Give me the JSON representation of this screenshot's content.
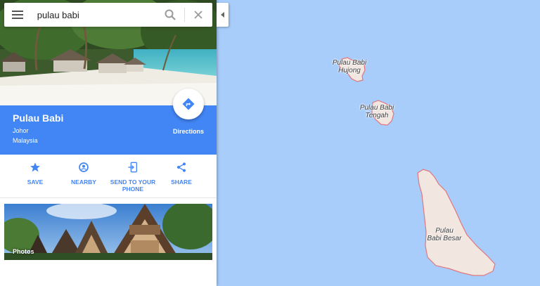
{
  "search": {
    "query": "pulau babi"
  },
  "place": {
    "name": "Pulau Babi",
    "state": "Johor",
    "country": "Malaysia",
    "directions_label": "Directions"
  },
  "actions": [
    {
      "label": "SAVE",
      "icon": "star-icon"
    },
    {
      "label": "NEARBY",
      "icon": "nearby-pin-icon"
    },
    {
      "label": "SEND TO YOUR PHONE",
      "icon": "send-to-phone-icon"
    },
    {
      "label": "SHARE",
      "icon": "share-icon"
    }
  ],
  "photos": {
    "label": "Photos"
  },
  "map": {
    "labels": {
      "hujong_1": "Pulau Babi",
      "hujong_2": "Hujong",
      "tengah_1": "Pulau Babi",
      "tengah_2": "Tengah",
      "besar_1": "Pulau",
      "besar_2": "Babi Besar"
    },
    "colors": {
      "water": "#a8cdfb",
      "land": "#f2e6e1",
      "coast": "#e1767c"
    }
  },
  "colors": {
    "accent": "#4285f4"
  }
}
